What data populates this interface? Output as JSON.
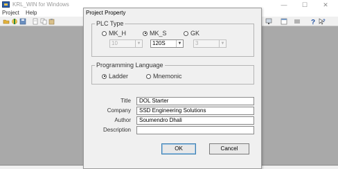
{
  "app": {
    "title": "KRL_WIN for Windows",
    "window_controls": {
      "minimize": "—",
      "maximize": "☐",
      "close": "✕"
    }
  },
  "menu": {
    "items": [
      "Project",
      "Help"
    ]
  },
  "toolbar": {
    "left_icons": [
      "open-folder-icon",
      "new-project-icon",
      "save-icon",
      "cut-icon",
      "copy-icon",
      "paste-icon"
    ],
    "right_icons": [
      "monitor-icon",
      "window-icon",
      "list-icon",
      "help-icon",
      "context-help-icon"
    ]
  },
  "dialog": {
    "title": "Project Property",
    "plc_type": {
      "legend": "PLC Type",
      "options": [
        {
          "label": "MK_H",
          "selected": false
        },
        {
          "label": "MK_S",
          "selected": true
        },
        {
          "label": "GK",
          "selected": false
        }
      ],
      "model_selects": [
        {
          "value": "10",
          "enabled": false
        },
        {
          "value": "120S",
          "enabled": true
        },
        {
          "value": "3",
          "enabled": false
        }
      ]
    },
    "language": {
      "legend": "Programming Language",
      "options": [
        {
          "label": "Ladder",
          "selected": true
        },
        {
          "label": "Mnemonic",
          "selected": false
        }
      ]
    },
    "fields": {
      "title": {
        "label": "Title",
        "value": "DOL Starter"
      },
      "company": {
        "label": "Company",
        "value": "SSD Engineering Solutions"
      },
      "author": {
        "label": "Author",
        "value": "Soumendro Dhali"
      },
      "description": {
        "label": "Description",
        "value": ""
      }
    },
    "ok_label": "OK",
    "cancel_label": "Cancel"
  },
  "colors": {
    "workspace": "#a9a9a9",
    "dialog_bg": "#f0f0f0",
    "default_button_border": "#3c7fb1"
  }
}
